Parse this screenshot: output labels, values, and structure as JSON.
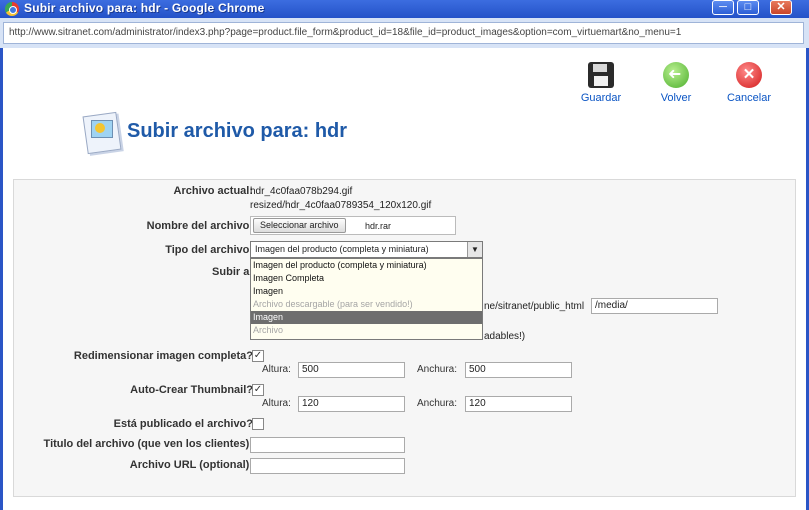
{
  "window": {
    "title": "Subir archivo para: hdr - Google Chrome",
    "minimize": "─",
    "maximize": "□",
    "close": "✕"
  },
  "address_bar": {
    "url": "http://www.sitranet.com/administrator/index3.php?page=product.file_form&product_id=18&file_id=product_images&option=com_virtuemart&no_menu=1"
  },
  "toolbar": {
    "save_label": "Guardar",
    "save_icon": "floppy-disk-icon",
    "back_label": "Volver",
    "back_icon": "back-arrow-icon",
    "cancel_label": "Cancelar",
    "cancel_icon": "cancel-x-icon",
    "cancel_glyph": "✕"
  },
  "page": {
    "heading": "Subir archivo para: hdr",
    "heading_color": "#1f5aa8"
  },
  "form": {
    "current_file": {
      "label": "Archivo actual:",
      "file": "hdr_4c0faa078b294.gif",
      "resized": "resized/hdr_4c0faa0789354_120x120.gif"
    },
    "file_name": {
      "label": "Nombre del archivo:",
      "button": "Seleccionar archivo",
      "selected": "hdr.rar"
    },
    "file_type": {
      "label": "Tipo del archivo:",
      "selected": "Imagen del producto (completa y miniatura)",
      "arrow": "▼",
      "options": [
        "Imagen del producto (completa y miniatura)",
        "Imagen Completa",
        "Imagen",
        "Archivo descargable (para ser vendido!)",
        "Imagen",
        "Archivo"
      ]
    },
    "upload_to": {
      "label": "Subir a:",
      "path_prefix": "ne/sitranet/public_html",
      "path_value": "/media/",
      "note": "adables!)"
    },
    "resize_full": {
      "label": "Redimensionar imagen completa?",
      "check": "✓",
      "height_label": "Altura:",
      "height": "500",
      "width_label": "Anchura:",
      "width": "500"
    },
    "auto_thumb": {
      "label": "Auto-Crear Thumbnail?",
      "check": "✓",
      "height_label": "Altura:",
      "height": "120",
      "width_label": "Anchura:",
      "width": "120"
    },
    "published": {
      "label": "Está publicado el archivo?"
    },
    "title": {
      "label": "Titulo del archivo (que ven los clientes):",
      "value": ""
    },
    "url": {
      "label": "Archivo URL (optional):",
      "value": ""
    }
  }
}
